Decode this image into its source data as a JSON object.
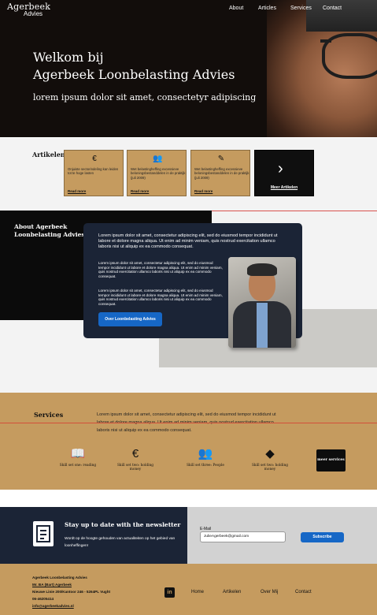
{
  "header": {
    "logo_line1": "Agerbeek",
    "logo_line2": "Advies",
    "nav": [
      "About",
      "Articles",
      "Services",
      "Contact"
    ]
  },
  "hero": {
    "title_line1": "Welkom bij",
    "title_line2": "Agerbeek Loonbelasting Advies",
    "subtitle": "lorem ipsum dolor sit amet, consectetyr adipiscing"
  },
  "articles": {
    "label": "Artikelen",
    "cards": [
      {
        "icon": "hand-euro-icon",
        "text": "Onjuiste sectorindeling kan leiden tot te hoge lasten",
        "link": "Read more"
      },
      {
        "icon": "people-icon",
        "text": "Wet belastingheffing excessieve beloningsbestanddelen in de praktijk (juli 2009)",
        "link": "Read more"
      },
      {
        "icon": "document-edit-icon",
        "text": "Wet belastingheffing excessieve beloningsbestanddelen in de praktijk (juli 2009)",
        "link": "Read more"
      }
    ],
    "more": "Meer Artikelen"
  },
  "about": {
    "title_line1": "About Agerbeek",
    "title_line2": "Loonbelasting Advies",
    "lead": "Lorem ipsum dolor sit amet, consectetur adipiscing elit, sed do eiusmod tempor incididunt ut labore et dolore magna aliqua. Ut enim ad minim veniam, quis nostrud exercitation ullamco laboris nisi ut aliquip ex ea commodo consequat.",
    "para1": "Lorem ipsum dolor sit amet, consectetur adipiscing elit, sed do eiusmod tempor incididunt ut labore et dolore magna aliqua. Ut enim ad minim veniam, quis nostrud exercitation ullamco laboris nisi ut aliquip ex ea commodo consequat.",
    "para2": "Lorem ipsum dolor sit amet, consectetur adipiscing elit, sed do eiusmod tempor incididunt ut labore et dolore magna aliqua. Ut enim ad minim veniam, quis nostrud exercitation ullamco laboris nisi ut aliquip ex ea commodo consequat.",
    "button": "Over Loonbelasting Advies"
  },
  "services": {
    "title": "Services",
    "text": "Lorem ipsum dolor sit amet, consectetur adipiscing elit, sed do eiusmod tempor incididunt ut labore et dolore magna aliqua. Ut enim ad minim veniam, quis nostrud exercitation ullamco laboris nisi ut aliquip ex ea commodo consequat.",
    "items": [
      {
        "icon": "book-icon",
        "label": "Skill set one: reading"
      },
      {
        "icon": "hand-euro-icon",
        "label": "Skill set two: holding money"
      },
      {
        "icon": "people-icon",
        "label": "Skill set three: People"
      },
      {
        "icon": "diamond-icon",
        "label": "Skill set two: holding money"
      }
    ],
    "more": "meer services"
  },
  "newsletter": {
    "title": "Stay up to date with the newsletter",
    "text": "Wordt op de hoogte gehouden van actualiteiten op het gebied van loonheffingen!",
    "email_label": "E-Mail",
    "email_value": "JulieAgerbeek@gmail.com",
    "button": "Subscribe"
  },
  "footer": {
    "company": "Agerbeek Loonbelasting Advies",
    "person": "Mr. BA (Bart) Agerbeek",
    "address": "Nieuwe Linie 200/Kantoor 246 - 5264PL Vught",
    "phone": "06-46205414",
    "email": "info@agerbeekadvies.nl",
    "linkedin": "in",
    "nav": [
      "Home",
      "Artikelen",
      "Over Mij",
      "Contact"
    ]
  },
  "colors": {
    "gold": "#c59b5f",
    "navy": "#1b2436",
    "blue": "#1667c6",
    "black": "#0b0b0b"
  }
}
